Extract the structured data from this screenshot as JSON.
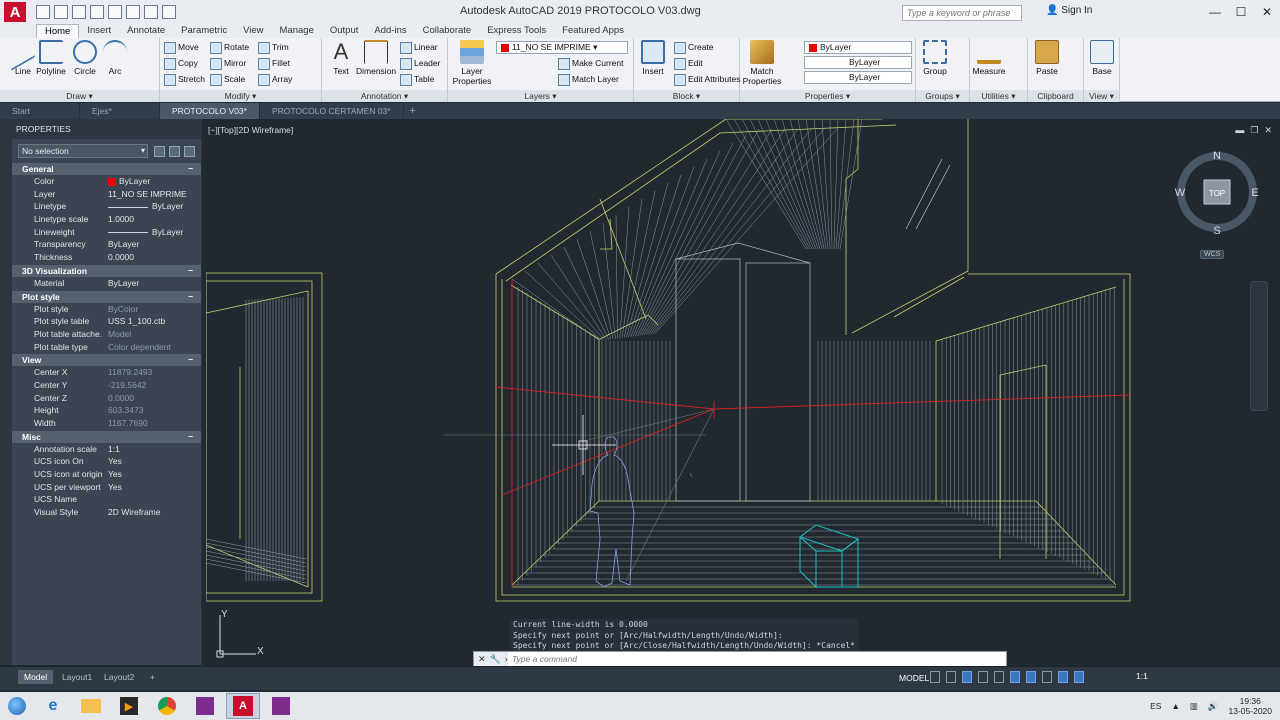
{
  "window": {
    "title": "Autodesk AutoCAD 2019    PROTOCOLO V03.dwg",
    "search_placeholder": "Type a keyword or phrase",
    "signin": "Sign In"
  },
  "ribbon_tabs": [
    "Home",
    "Insert",
    "Annotate",
    "Parametric",
    "View",
    "Manage",
    "Output",
    "Add-ins",
    "Collaborate",
    "Express Tools",
    "Featured Apps"
  ],
  "ribbon": {
    "draw": {
      "title": "Draw ▾",
      "line": "Line",
      "polyline": "Polyline",
      "circle": "Circle",
      "arc": "Arc"
    },
    "modify": {
      "title": "Modify ▾",
      "move": "Move",
      "rotate": "Rotate",
      "trim": "Trim",
      "copy": "Copy",
      "mirror": "Mirror",
      "fillet": "Fillet",
      "stretch": "Stretch",
      "scale": "Scale",
      "array": "Array"
    },
    "annotation": {
      "title": "Annotation ▾",
      "text": "Text",
      "dimension": "Dimension",
      "linear": "Linear",
      "leader": "Leader",
      "table": "Table"
    },
    "layers": {
      "title": "Layers ▾",
      "layer_properties": "Layer Properties",
      "current_layer": "11_NO SE IMPRIME",
      "make_current": "Make Current",
      "match_layer": "Match Layer"
    },
    "block": {
      "title": "Block ▾",
      "insert": "Insert",
      "create": "Create",
      "edit": "Edit",
      "edit_attributes": "Edit Attributes"
    },
    "properties": {
      "title": "Properties ▾",
      "match_properties": "Match Properties",
      "color": "ByLayer",
      "linetype": "ByLayer",
      "lineweight": "ByLayer"
    },
    "groups": {
      "title": "Groups ▾",
      "group": "Group"
    },
    "utilities": {
      "title": "Utilities ▾",
      "measure": "Measure"
    },
    "clipboard": {
      "title": "Clipboard",
      "paste": "Paste"
    },
    "view": {
      "title": "View ▾",
      "base": "Base"
    }
  },
  "file_tabs": [
    "Start",
    "Ejes*",
    "PROTOCOLO V03*",
    "PROTOCOLO CERTAMEN 03*"
  ],
  "properties_palette": {
    "title": "PROPERTIES",
    "selection": "No selection",
    "sections": [
      {
        "name": "General",
        "rows": [
          {
            "k": "Color",
            "v": "ByLayer",
            "swatch": true
          },
          {
            "k": "Layer",
            "v": "11_NO SE IMPRIME"
          },
          {
            "k": "Linetype",
            "v": "ByLayer",
            "line": true
          },
          {
            "k": "Linetype scale",
            "v": "1.0000"
          },
          {
            "k": "Lineweight",
            "v": "ByLayer",
            "line": true
          },
          {
            "k": "Transparency",
            "v": "ByLayer"
          },
          {
            "k": "Thickness",
            "v": "0.0000"
          }
        ]
      },
      {
        "name": "3D Visualization",
        "rows": [
          {
            "k": "Material",
            "v": "ByLayer"
          }
        ]
      },
      {
        "name": "Plot style",
        "rows": [
          {
            "k": "Plot style",
            "v": "ByColor",
            "dim": true
          },
          {
            "k": "Plot style table",
            "v": "USS 1_100.ctb"
          },
          {
            "k": "Plot table attache...",
            "v": "Model",
            "dim": true
          },
          {
            "k": "Plot table type",
            "v": "Color dependent",
            "dim": true
          }
        ]
      },
      {
        "name": "View",
        "rows": [
          {
            "k": "Center X",
            "v": "11879.2493",
            "dim": true
          },
          {
            "k": "Center Y",
            "v": "-219.5642",
            "dim": true
          },
          {
            "k": "Center Z",
            "v": "0.0000",
            "dim": true
          },
          {
            "k": "Height",
            "v": "603.3473",
            "dim": true
          },
          {
            "k": "Width",
            "v": "1167.7690",
            "dim": true
          }
        ]
      },
      {
        "name": "Misc",
        "rows": [
          {
            "k": "Annotation scale",
            "v": "1:1"
          },
          {
            "k": "UCS icon On",
            "v": "Yes"
          },
          {
            "k": "UCS icon at origin",
            "v": "Yes"
          },
          {
            "k": "UCS per viewport",
            "v": "Yes"
          },
          {
            "k": "UCS Name",
            "v": ""
          },
          {
            "k": "Visual Style",
            "v": "2D Wireframe"
          }
        ]
      }
    ]
  },
  "viewport": {
    "label": "[−][Top][2D Wireframe]",
    "viewcube": {
      "n": "N",
      "s": "S",
      "e": "E",
      "w": "W",
      "face": "TOP",
      "wcs": "WCS"
    },
    "ucs": {
      "x": "X",
      "y": "Y"
    }
  },
  "command": {
    "history": [
      "Current line-width is 0.0000",
      "Specify next point or [Arc/Halfwidth/Length/Undo/Width]:",
      "Specify next point or [Arc/Close/Halfwidth/Length/Undo/Width]: *Cancel*"
    ],
    "placeholder": "Type a command"
  },
  "layout_tabs": [
    "Model",
    "Layout1",
    "Layout2"
  ],
  "status": {
    "model": "MODEL",
    "scale": "1:1"
  },
  "taskbar": {
    "lang": "ES",
    "time": "19:36",
    "date": "13-05-2020"
  },
  "colors": {
    "accent": "#c8102e",
    "canvas": "#212830",
    "wall": "#c9d36b",
    "line_red": "#d62020",
    "cyan": "#1fc2c2",
    "person": "#8e9fe6"
  }
}
